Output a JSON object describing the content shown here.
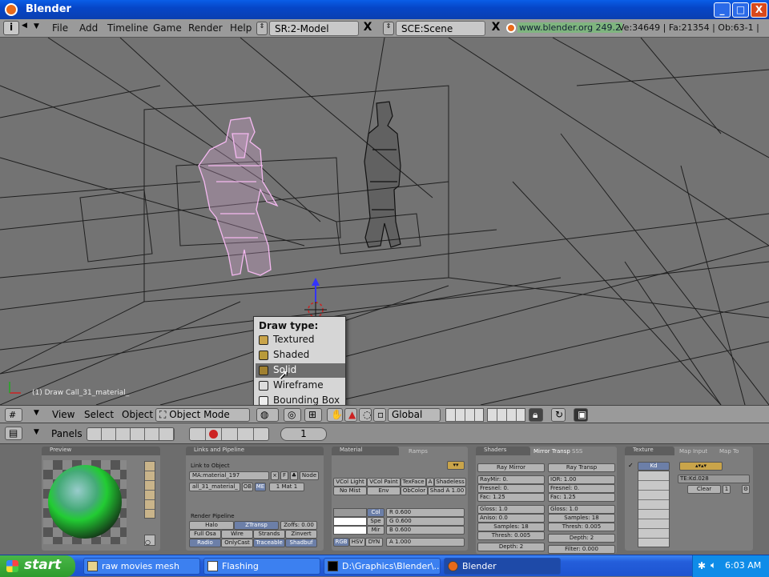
{
  "window": {
    "title": "Blender",
    "minimize": "_",
    "maximize": "□",
    "close": "X"
  },
  "menubar": {
    "items": [
      "File",
      "Add",
      "Timeline",
      "Game",
      "Render",
      "Help"
    ],
    "screen_field": "SR:2-Model",
    "scene_field": "SCE:Scene",
    "url": "www.blender.org 249.2",
    "stats": "Ve:34649 | Fa:21354 | Ob:63-1 |",
    "close_x": "X"
  },
  "viewport": {
    "status_text": "(1) Draw Call_31_material_"
  },
  "draw_popup": {
    "title": "Draw type:",
    "items": [
      "Textured",
      "Shaded",
      "Solid",
      "Wireframe",
      "Bounding Box"
    ],
    "selected": "Solid"
  },
  "header3d": {
    "menus": [
      "View",
      "Select",
      "Object"
    ],
    "mode": "Object Mode",
    "orientation": "Global"
  },
  "buttons_header": {
    "label": "Panels",
    "frame": "1"
  },
  "panels": {
    "preview": {
      "title": "Preview"
    },
    "links": {
      "title": "Links and Pipeline",
      "link_to_object": "Link to Object",
      "ma_field": "MA:material_197",
      "f_btn": "F",
      "node_btn": "Node",
      "me_field": "all_31_material_",
      "ob_btn": "OB",
      "me_btn": "ME",
      "mat_field": "1 Mat 1",
      "render_pipeline": "Render Pipeline",
      "pipeline_rows": [
        [
          "Halo",
          "ZTransp",
          "Zoffs: 0.00"
        ],
        [
          "Full Osa",
          "Wire",
          "Strands",
          "Zinvert"
        ],
        [
          "Radio",
          "OnlyCast",
          "Traceable",
          "Shadbuf"
        ]
      ]
    },
    "material": {
      "title": "Material",
      "ramps_tab": "Ramps",
      "row1": [
        "VCol Light",
        "VCol Paint",
        "TexFace",
        "A",
        "Shadeless"
      ],
      "row2": [
        "No Mist",
        "Env",
        "ObColor",
        "Shad A 1.00"
      ],
      "col_btns": [
        "Col",
        "Spe",
        "Mir"
      ],
      "rgb": [
        "R 0.600",
        "G 0.600",
        "B 0.600"
      ],
      "modes": [
        "RGB",
        "HSV",
        "DYN"
      ],
      "alpha": "A 1.000"
    },
    "shaders": {
      "title": "Shaders",
      "tabs": [
        "Mirror Transp",
        "SSS"
      ],
      "ray_mirror": "Ray Mirror",
      "ray_transp": "Ray Transp",
      "left": [
        "RayMir: 0.",
        "Fresnel: 0.",
        "Fac: 1.25",
        "Gloss: 1.0",
        "Aniso: 0.0",
        "Samples: 18",
        "Thresh: 0.005",
        "Depth: 2"
      ],
      "right": [
        "IOR: 1.00",
        "Fresnel: 0.",
        "Fac: 1.25",
        "Gloss: 1.0",
        "Samples: 18",
        "Thresh: 0.005",
        "Depth: 2",
        "Filter: 0.000"
      ]
    },
    "texture": {
      "title": "Texture",
      "tabs": [
        "Map Input",
        "Map To"
      ],
      "active_slot": "Kd",
      "tex_field": "TE:Kd.028",
      "clear": "Clear",
      "num": "1"
    }
  },
  "taskbar": {
    "start": "start",
    "tasks": [
      "raw movies mesh",
      "Flashing",
      "D:\\Graphics\\Blender\\...",
      "Blender"
    ],
    "clock": "6:03 AM"
  }
}
